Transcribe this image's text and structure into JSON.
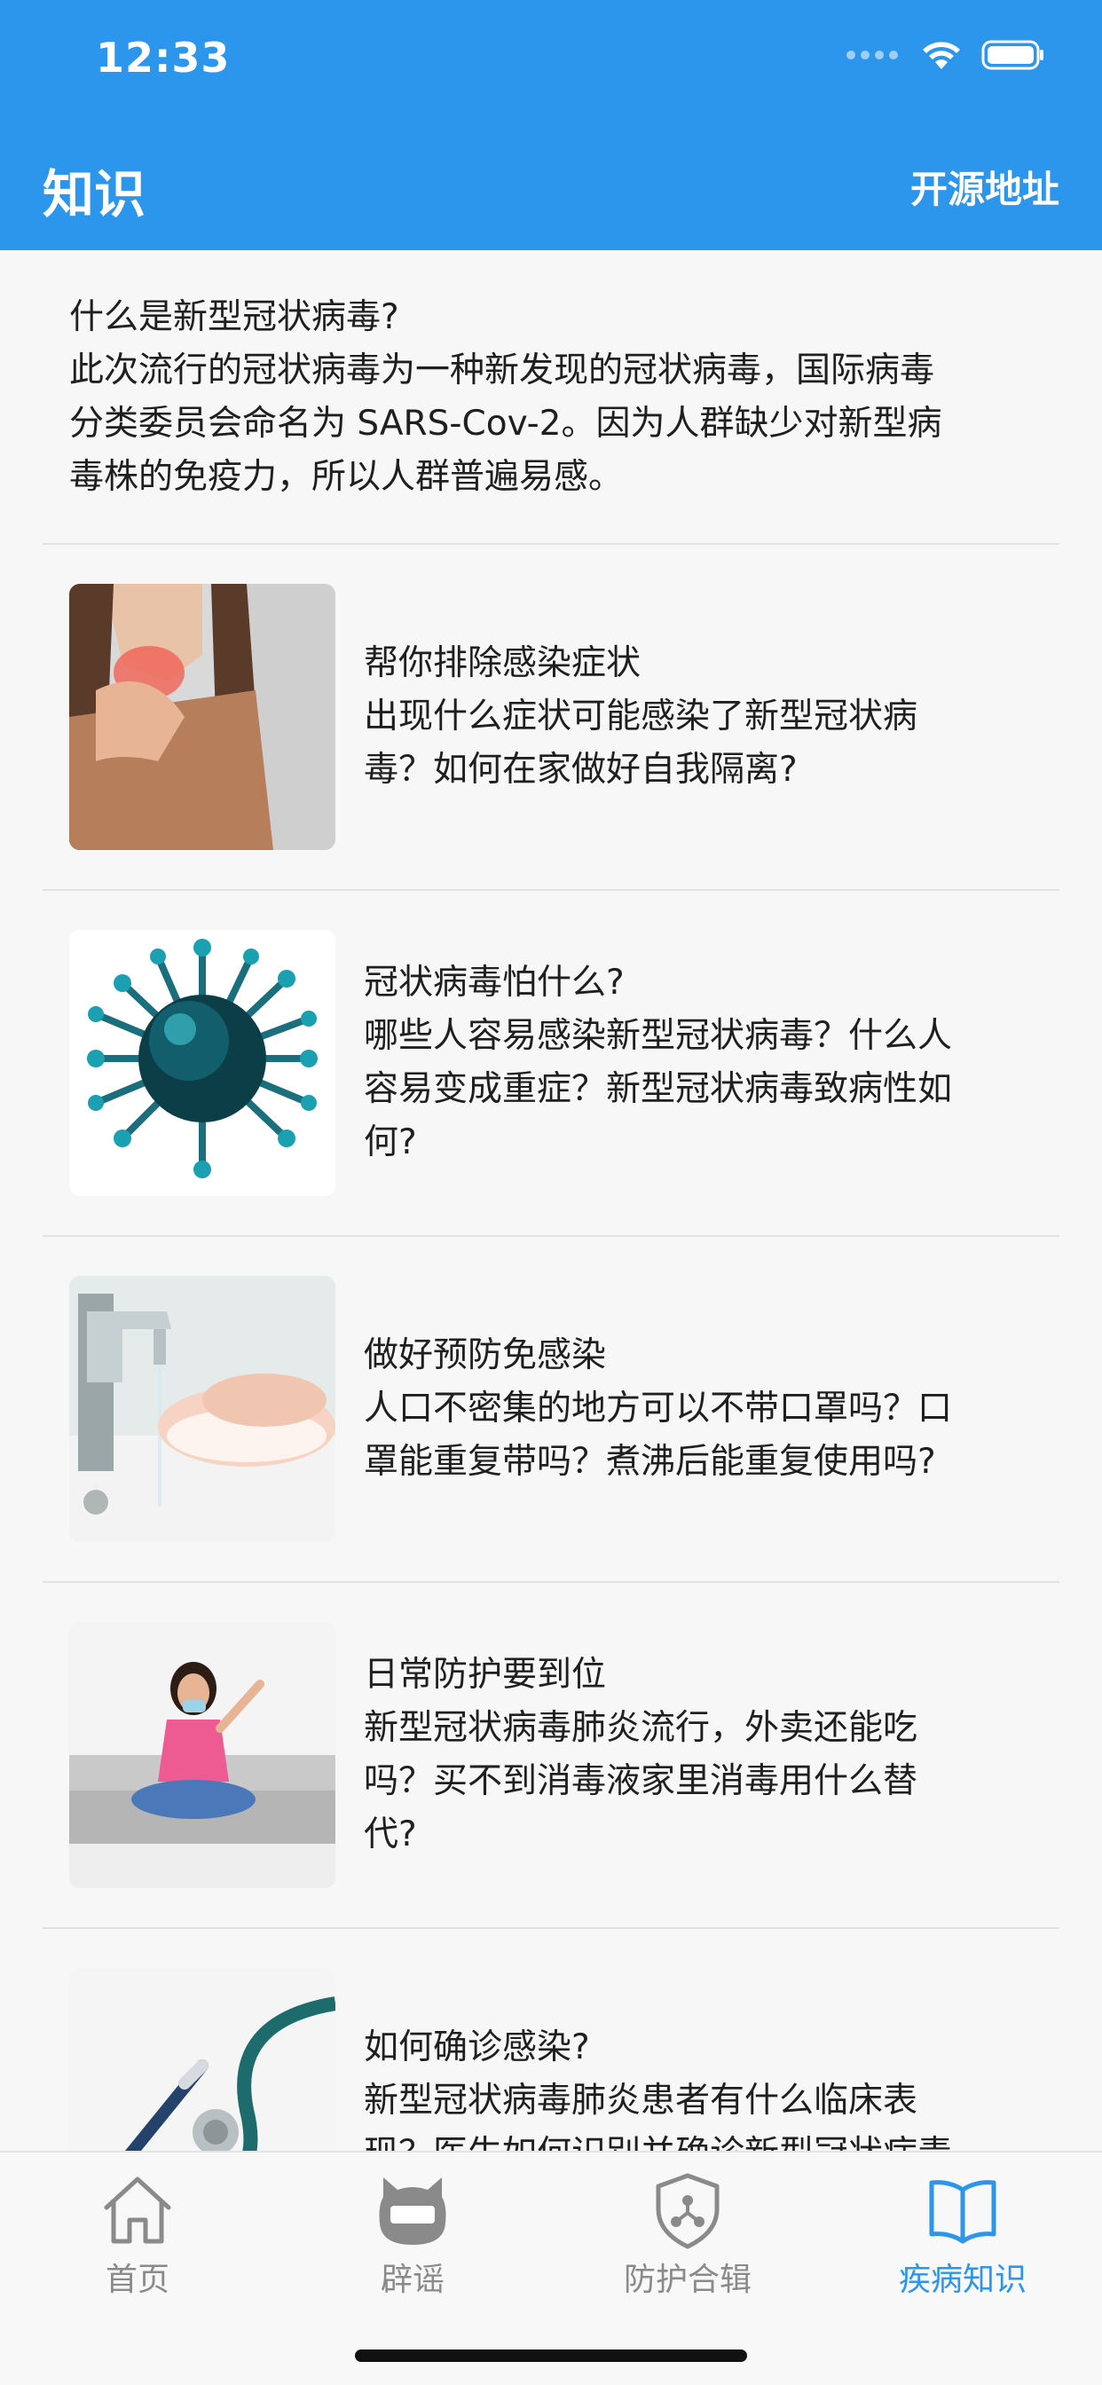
{
  "status_bar": {
    "time": "12:33",
    "wifi_icon": "wifi-icon",
    "battery_icon": "battery-icon"
  },
  "nav": {
    "title": "知识",
    "action": "开源地址"
  },
  "intro": {
    "line1": "什么是新型冠状病毒?",
    "line2": "此次流行的冠状病毒为一种新发现的冠状病毒，国际病毒",
    "line3": "分类委员会命名为 SARS-Cov-2。因为人群缺少对新型病",
    "line4": "毒株的免疫力，所以人群普遍易感。"
  },
  "items": [
    {
      "title": "帮你排除感染症状",
      "lines": [
        "出现什么症状可能感染了新型冠状病",
        "毒？如何在家做好自我隔离?"
      ]
    },
    {
      "title": "冠状病毒怕什么?",
      "lines": [
        "哪些人容易感染新型冠状病毒？什么人",
        "容易变成重症？新型冠状病毒致病性如",
        "何?"
      ]
    },
    {
      "title": "做好预防免感染",
      "lines": [
        "人口不密集的地方可以不带口罩吗？口",
        "罩能重复带吗？煮沸后能重复使用吗?"
      ]
    },
    {
      "title": "日常防护要到位",
      "lines": [
        "新型冠状病毒肺炎流行，外卖还能吃",
        "吗？买不到消毒液家里消毒用什么替",
        "代?"
      ]
    },
    {
      "title": "如何确诊感染?",
      "lines": [
        "新型冠状病毒肺炎患者有什么临床表",
        "现？医生如何识别并确诊新型冠状病毒"
      ]
    }
  ],
  "tabbar": {
    "tabs": [
      {
        "label": "首页",
        "icon": "home-icon"
      },
      {
        "label": "辟谣",
        "icon": "mascot-icon"
      },
      {
        "label": "防护合辑",
        "icon": "shield-icon"
      },
      {
        "label": "疾病知识",
        "icon": "book-icon"
      }
    ],
    "active_index": 3
  },
  "colors": {
    "brand": "#2c95ec",
    "inactive": "#8a8a8a",
    "text": "#1f1f1f",
    "background": "#f7f7f7"
  }
}
